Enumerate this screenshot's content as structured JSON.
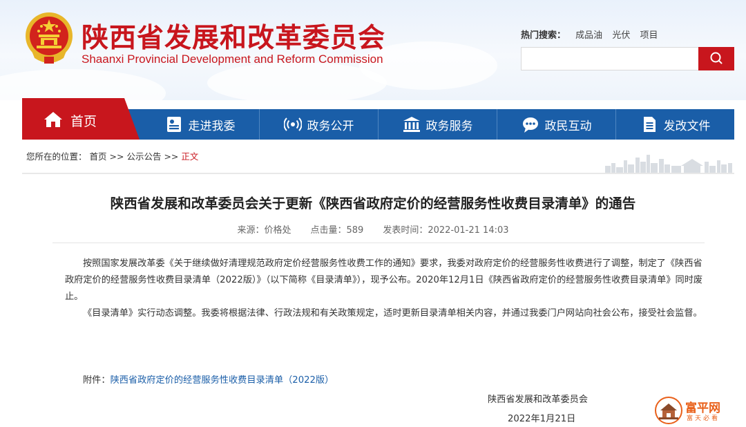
{
  "header": {
    "title_cn": "陕西省发展和改革委员会",
    "title_en": "Shaanxi Provincial Development and Reform Commission",
    "hot_label": "热门搜索：",
    "hot_items": [
      "成品油",
      "光伏",
      "项目"
    ],
    "search_placeholder": ""
  },
  "nav": {
    "home": "首页",
    "items": [
      {
        "label": "走进我委",
        "icon": "person-card-icon"
      },
      {
        "label": "政务公开",
        "icon": "broadcast-icon"
      },
      {
        "label": "政务服务",
        "icon": "government-building-icon"
      },
      {
        "label": "政民互动",
        "icon": "chat-icon"
      },
      {
        "label": "发改文件",
        "icon": "document-icon"
      }
    ]
  },
  "breadcrumb": {
    "prefix": "您所在的位置：",
    "items": [
      "首页",
      "公示公告"
    ],
    "separator": ">>",
    "current": "正文"
  },
  "article": {
    "title": "陕西省发展和改革委员会关于更新《陕西省政府定价的经营服务性收费目录清单》的通告",
    "source_label": "来源：",
    "source": "价格处",
    "clicks_label": "点击量：",
    "clicks": "589",
    "time_label": "发表时间：",
    "time": "2022-01-21 14:03",
    "paragraphs": [
      "按照国家发展改革委《关于继续做好清理规范政府定价经营服务性收费工作的通知》要求，我委对政府定价的经营服务性收费进行了调整，制定了《陕西省政府定价的经营服务性收费目录清单（2022版）》（以下简称《目录清单》），现予公布。2020年12月1日《陕西省政府定价的经营服务性收费目录清单》同时废止。",
      "《目录清单》实行动态调整。我委将根据法律、行政法规和有关政策规定，适时更新目录清单相关内容，并通过我委门户网站向社会公布，接受社会监督。"
    ],
    "attachment_label": "附件：",
    "attachment": "陕西省政府定价的经营服务性收费目录清单（2022版）",
    "sign_org": "陕西省发展和改革委员会",
    "sign_date": "2022年1月21日"
  },
  "watermark": {
    "name": "富平网",
    "sub": "富天必看"
  },
  "colors": {
    "brand_red": "#c8161d",
    "nav_blue": "#1a5ea8",
    "link_blue": "#1a5ea8",
    "watermark_orange": "#e9601a"
  }
}
